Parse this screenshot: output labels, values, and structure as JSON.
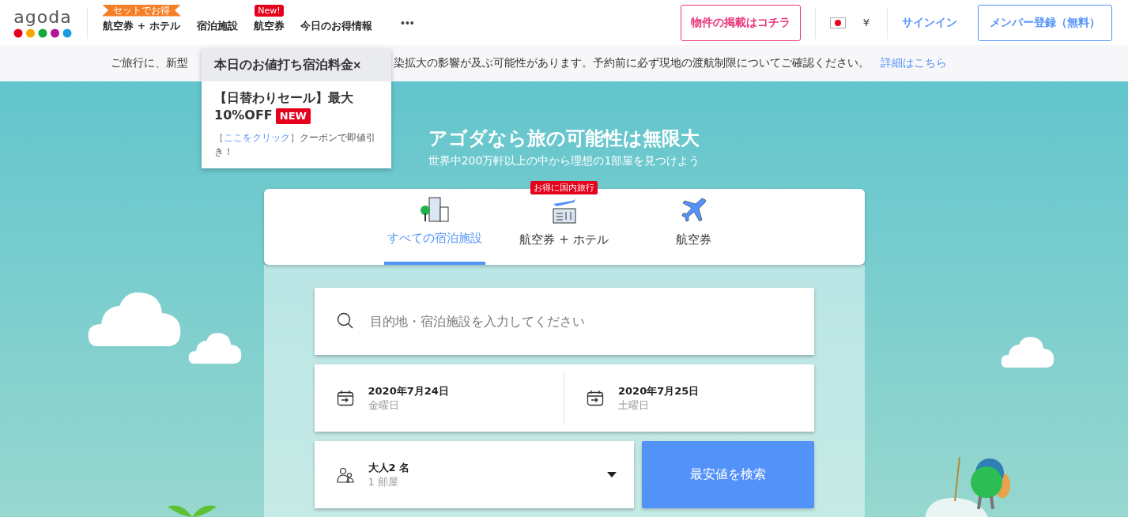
{
  "header": {
    "logo": "agoda",
    "nav": [
      {
        "label": "航空券 + ホテル",
        "badge": "セットでお得",
        "kind": "ribbon"
      },
      {
        "label": "宿泊施設"
      },
      {
        "label": "航空券",
        "badge": "New!",
        "kind": "tag"
      },
      {
        "label": "今日のお得情報"
      }
    ],
    "more": "•••",
    "list_property": "物件の掲載はコチラ",
    "currency": "¥",
    "sign_in": "サインイン",
    "register": "メンバー登録（無料）"
  },
  "notice": {
    "text_before": "ご旅行に、新型",
    "text_after": "染拡大の影響が及ぶ可能性があります。予約前に必ず現地の渡航制限についてご確認ください。",
    "link": "詳細はこちら"
  },
  "popup": {
    "title": "本日のお値打ち宿泊料金",
    "close": "×",
    "headline": "【日替わりセール】最大10%OFF",
    "badge": "NEW",
    "body_prefix": "［",
    "body_link": "ここをクリック",
    "body_suffix": "］クーポンで即値引き！"
  },
  "hero": {
    "title": "アゴダなら旅の可能性は無限大",
    "subtitle": "世界中200万軒以上の中から理想の1部屋を見つけよう"
  },
  "tabs": [
    {
      "label": "すべての宿泊施設",
      "kind": "hotels",
      "selected": true
    },
    {
      "label": "航空券 + ホテル",
      "kind": "package",
      "selected": false,
      "badge": "お得に国内旅行"
    },
    {
      "label": "航空券",
      "kind": "flights",
      "selected": false
    }
  ],
  "search": {
    "placeholder": "目的地・宿泊施設を入力してください",
    "check_in": {
      "date": "2020年7月24日",
      "day": "金曜日"
    },
    "check_out": {
      "date": "2020年7月25日",
      "day": "土曜日"
    },
    "guests": {
      "adults": "大人2 名",
      "rooms": "1 部屋"
    },
    "button": "最安値を検索"
  }
}
